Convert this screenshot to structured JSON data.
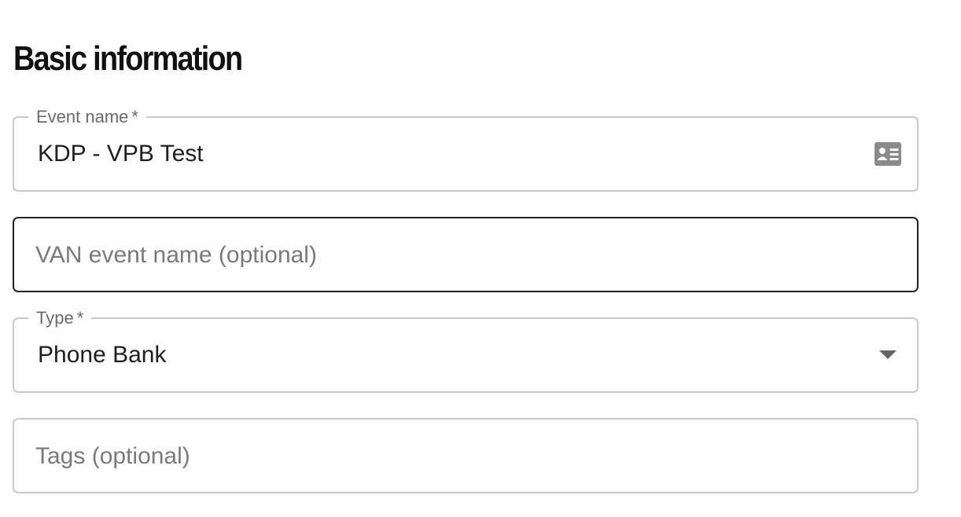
{
  "section": {
    "title": "Basic information"
  },
  "fields": {
    "event_name": {
      "label": "Event name",
      "required_marker": "*",
      "value": "KDP - VPB Test",
      "icon": "contact-card-icon"
    },
    "van_event_name": {
      "placeholder": "VAN event name (optional)"
    },
    "type": {
      "label": "Type",
      "required_marker": "*",
      "value": "Phone Bank",
      "icon": "caret-down-icon"
    },
    "tags": {
      "placeholder": "Tags (optional)"
    }
  },
  "colors": {
    "border": "#c9c9c9",
    "focused_border": "#222222",
    "label": "#6a6a6a",
    "placeholder": "#7a7a7a",
    "text": "#1e1e1e",
    "icon": "#8a8a8a"
  }
}
